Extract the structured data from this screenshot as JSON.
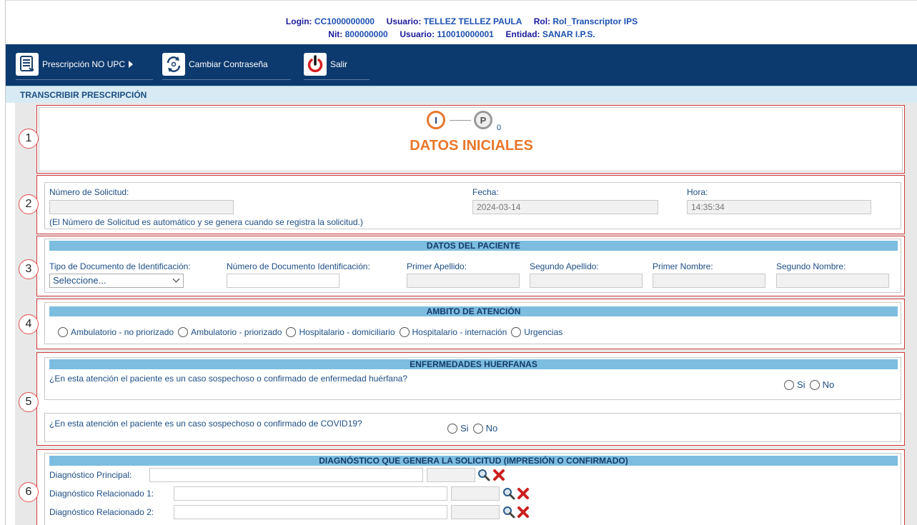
{
  "header": {
    "line1": [
      {
        "k": "Login:",
        "v": "CC1000000000"
      },
      {
        "k": "Usuario:",
        "v": "TELLEZ TELLEZ PAULA"
      },
      {
        "k": "Rol:",
        "v": "Rol_Transcriptor IPS"
      }
    ],
    "line2": [
      {
        "k": "Nit:",
        "v": "800000000"
      },
      {
        "k": "Usuario:",
        "v": "110010000001"
      },
      {
        "k": "Entidad:",
        "v": "SANAR I.P.S."
      }
    ]
  },
  "nav": {
    "items": [
      {
        "label": "Prescripción NO UPC",
        "icon": "document-icon"
      },
      {
        "label": "Cambiar Contraseña",
        "icon": "refresh-key-icon"
      },
      {
        "label": "Salir",
        "icon": "power-icon"
      }
    ]
  },
  "section_title": "TRANSCRIBIR PRESCRIPCIÓN",
  "markers": [
    "1",
    "2",
    "3",
    "4",
    "5",
    "6"
  ],
  "step": {
    "icon1_letter": "I",
    "icon2_letter": "P",
    "sub_index": "0",
    "title": "DATOS INICIALES"
  },
  "solicitud": {
    "numero_label": "Número de Solicitud:",
    "numero_value": "",
    "nota": "(El Número de Solicitud es automático y se genera cuando se registra la solicitud.)",
    "fecha_label": "Fecha:",
    "fecha_value": "2024-03-14",
    "hora_label": "Hora:",
    "hora_value": "14:35:34"
  },
  "paciente": {
    "header": "DATOS DEL PACIENTE",
    "tipo_doc_label": "Tipo de Documento de Identificación:",
    "tipo_doc_value": "Seleccione...",
    "num_doc_label": "Número de Documento Identificación:",
    "primer_apellido_label": "Primer Apellido:",
    "segundo_apellido_label": "Segundo Apellido:",
    "primer_nombre_label": "Primer Nombre:",
    "segundo_nombre_label": "Segundo Nombre:"
  },
  "ambito": {
    "header": "AMBITO DE ATENCIÓN",
    "options": [
      "Ambulatorio - no priorizado",
      "Ambulatorio - priorizado",
      "Hospitalario - domiciliario",
      "Hospitalario - internación",
      "Urgencias"
    ]
  },
  "huerfanas": {
    "header": "ENFERMEDADES HUERFANAS",
    "q1": "¿En esta atención el paciente es un caso sospechoso o confirmado de enfermedad huérfana?",
    "q2": "¿En esta atención el paciente es un caso sospechoso o confirmado de COVID19?",
    "si": "Si",
    "no": "No"
  },
  "diagnostico": {
    "header": "DIAGNÓSTICO QUE GENERA LA SOLICITUD (IMPRESIÓN O CONFIRMADO)",
    "principal_label": "Diagnóstico Principal:",
    "rel1_label": "Diagnóstico Relacionado 1:",
    "rel2_label": "Diagnóstico Relacionado 2:"
  },
  "colors": {
    "navbar": "#0c3a6e",
    "accent_orange": "#e8772a",
    "section_header": "#7dbde0",
    "marker_border": "#d23a3a",
    "label_blue": "#1d4e86",
    "delete_red": "#cc1f1f"
  }
}
